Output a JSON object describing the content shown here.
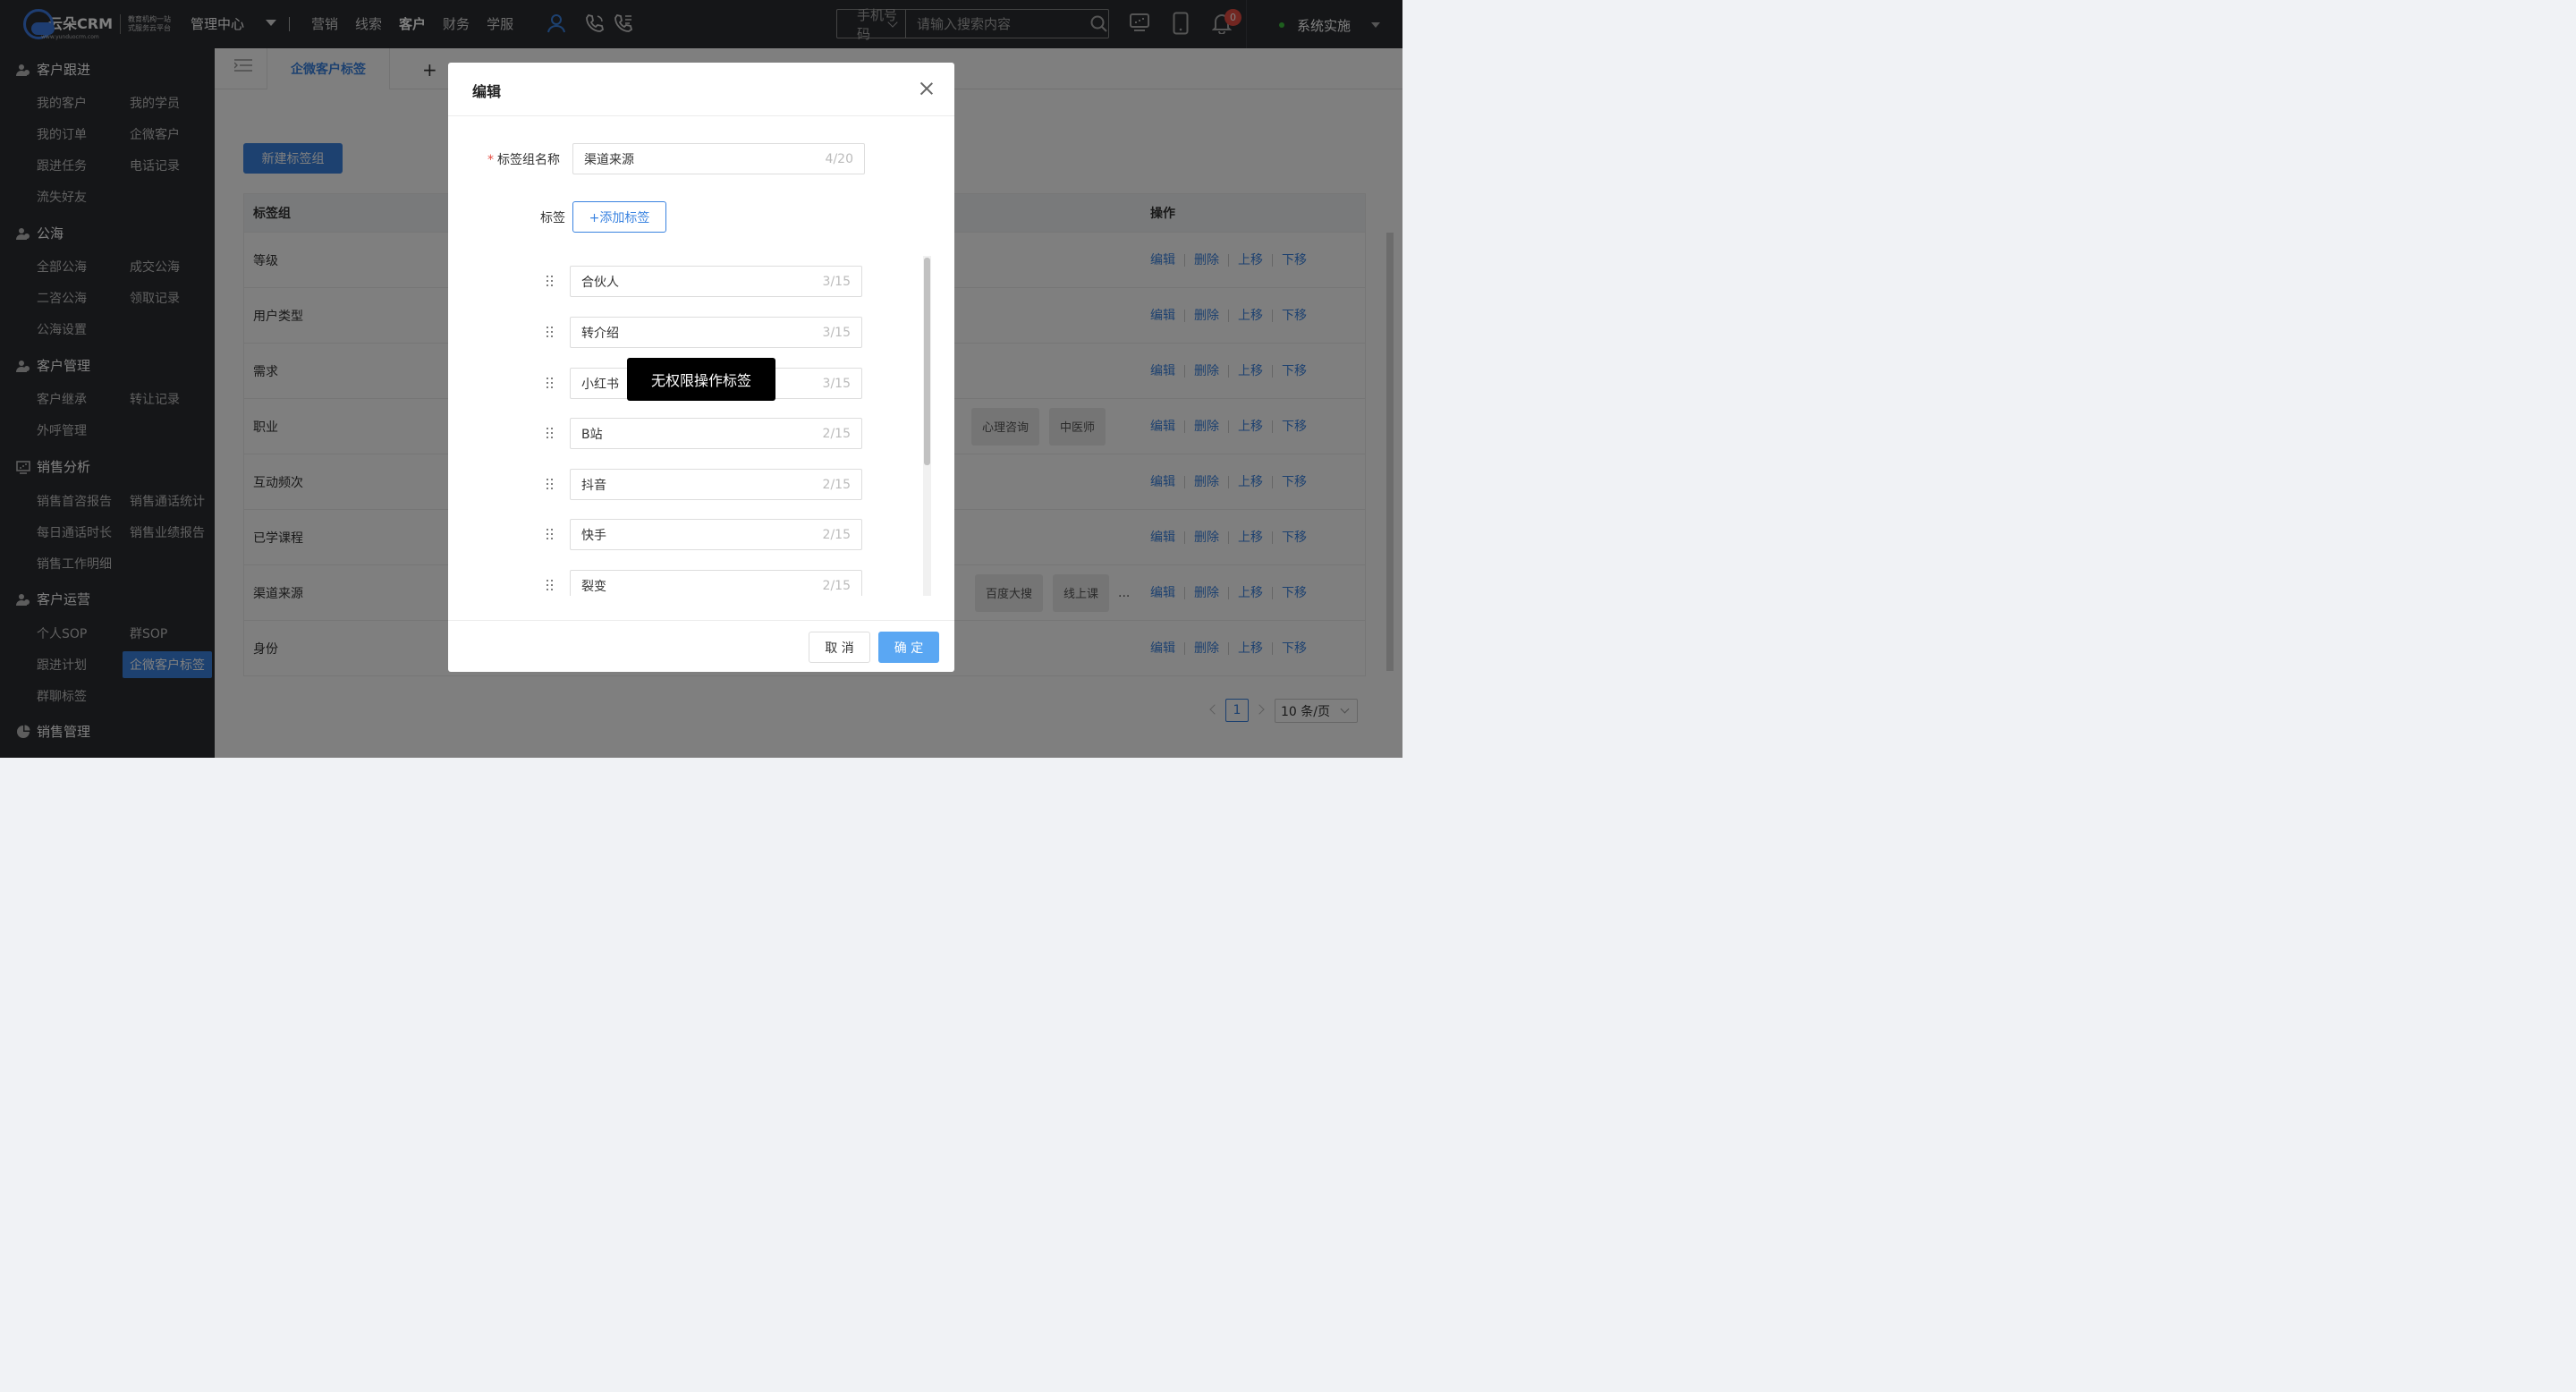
{
  "topbar": {
    "logo_text": "云朵CRM",
    "logo_url": "www.yunduocrm.com",
    "logo_slogan": "教育机构一站式服务云平台",
    "mgmt_center": "管理中心",
    "nav": [
      "营销",
      "线索",
      "客户",
      "财务",
      "学服"
    ],
    "active_nav": "客户",
    "search_type": "手机号码",
    "search_placeholder": "请输入搜索内容",
    "notif_count": "0",
    "user_name": "系统实施"
  },
  "sidebar": {
    "sections": [
      {
        "title": "客户跟进",
        "items": [
          "我的客户",
          "我的学员",
          "我的订单",
          "企微客户",
          "跟进任务",
          "电话记录",
          "流失好友"
        ]
      },
      {
        "title": "公海",
        "items": [
          "全部公海",
          "成交公海",
          "二咨公海",
          "领取记录",
          "公海设置"
        ]
      },
      {
        "title": "客户管理",
        "items": [
          "客户继承",
          "转让记录",
          "外呼管理"
        ]
      },
      {
        "title": "销售分析",
        "items": [
          "销售首咨报告",
          "销售通话统计",
          "每日通话时长",
          "销售业绩报告",
          "销售工作明细"
        ]
      },
      {
        "title": "客户运营",
        "items": [
          "个人SOP",
          "群SOP",
          "跟进计划",
          "企微客户标签",
          "群聊标签"
        ]
      },
      {
        "title": "销售管理",
        "items": []
      }
    ],
    "active_item": "企微客户标签"
  },
  "main": {
    "tab_label": "企微客户标签",
    "tab_add": "+",
    "new_group_btn": "新建标签组",
    "table": {
      "col_group": "标签组",
      "col_ops": "操作",
      "rows": [
        {
          "name": "等级",
          "chips": []
        },
        {
          "name": "用户类型",
          "chips": []
        },
        {
          "name": "需求",
          "chips": []
        },
        {
          "name": "职业",
          "chips": [
            "心理咨询",
            "中医师"
          ]
        },
        {
          "name": "互动频次",
          "chips": []
        },
        {
          "name": "已学课程",
          "chips": []
        },
        {
          "name": "渠道来源",
          "chips": [
            "百度大搜",
            "线上课"
          ],
          "more": "..."
        },
        {
          "name": "身份",
          "chips": []
        }
      ],
      "ops": [
        "编辑",
        "删除",
        "上移",
        "下移"
      ]
    },
    "pager": {
      "current": "1",
      "page_size": "10 条/页"
    }
  },
  "modal": {
    "title": "编辑",
    "name_label": "标签组名称",
    "name_value": "渠道来源",
    "name_count": "4/20",
    "tag_label": "标签",
    "add_tag_btn": "+添加标签",
    "tags": [
      {
        "value": "合伙人",
        "count": "3/15"
      },
      {
        "value": "转介绍",
        "count": "3/15"
      },
      {
        "value": "小红书",
        "count": "3/15"
      },
      {
        "value": "B站",
        "count": "2/15"
      },
      {
        "value": "抖音",
        "count": "2/15"
      },
      {
        "value": "快手",
        "count": "2/15"
      },
      {
        "value": "裂变",
        "count": "2/15"
      }
    ],
    "tooltip": "无权限操作标签",
    "cancel": "取 消",
    "confirm": "确 定"
  }
}
